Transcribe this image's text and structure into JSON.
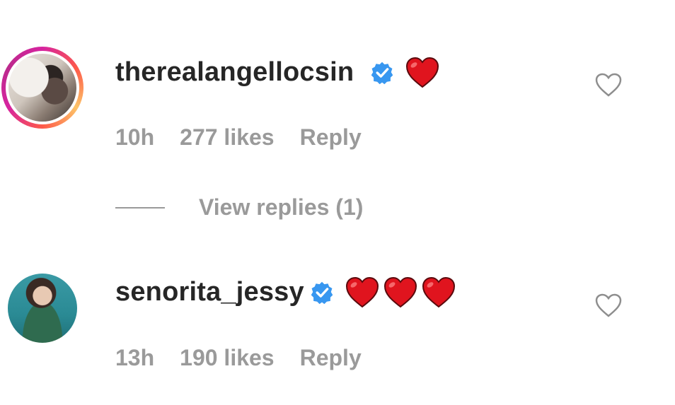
{
  "comments": [
    {
      "username": "therealangellocsin",
      "verified": true,
      "emoji_text": "❤️",
      "heart_count": 1,
      "time": "10h",
      "likes": "277 likes",
      "reply_label": "Reply",
      "view_replies": "View replies (1)",
      "avatar_story_ring": true
    },
    {
      "username": "senorita_jessy",
      "verified": true,
      "emoji_text": "❤️❤️❤️",
      "heart_count": 3,
      "time": "13h",
      "likes": "190 likes",
      "reply_label": "Reply",
      "avatar_story_ring": false
    }
  ],
  "icons": {
    "verified": "verified-badge-icon",
    "emoji": "red-heart-emoji-icon",
    "like": "heart-outline-icon"
  },
  "colors": {
    "username": "#262626",
    "meta": "#9a9a9a",
    "verified": "#3897f0",
    "emoji_heart": "#e0141e",
    "like_outline": "#8e8e8e"
  }
}
